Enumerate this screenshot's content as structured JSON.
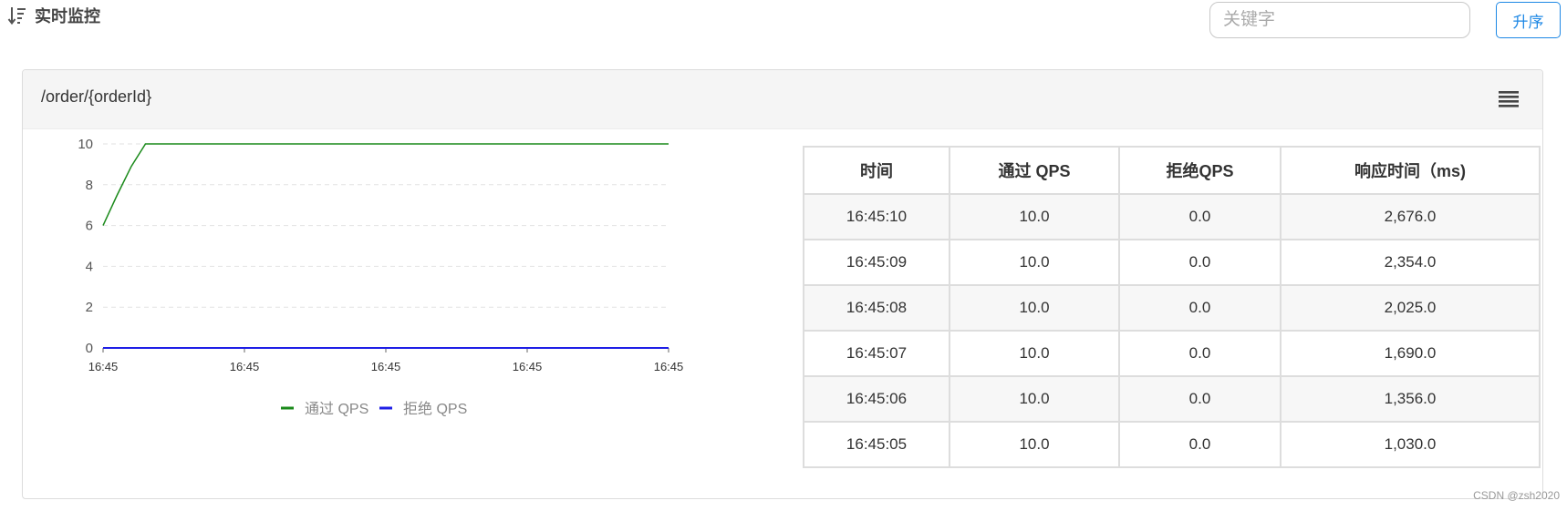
{
  "header": {
    "title": "实时监控",
    "sort_icon": "sort-descending-icon",
    "search_placeholder": "关键字",
    "search_value": "",
    "sort_button_label": "升序"
  },
  "panel": {
    "title": "/order/{orderId}",
    "menu_icon": "hamburger-menu-icon"
  },
  "chart_data": {
    "type": "line",
    "x": [
      "16:45",
      "16:45",
      "16:45",
      "16:45",
      "16:45"
    ],
    "ylim": [
      0,
      10
    ],
    "yticks": [
      0,
      2,
      4,
      6,
      8,
      10
    ],
    "grid": true,
    "legend_position": "bottom",
    "series": [
      {
        "name": "通过 QPS",
        "color": "#1a8a1a",
        "values": [
          6,
          7.5,
          8.9,
          10,
          10,
          10,
          10,
          10,
          10,
          10,
          10,
          10,
          10,
          10,
          10,
          10,
          10,
          10,
          10,
          10,
          10,
          10,
          10,
          10,
          10,
          10,
          10,
          10,
          10,
          10,
          10,
          10,
          10,
          10,
          10,
          10,
          10,
          10,
          10,
          10,
          10
        ]
      },
      {
        "name": "拒绝 QPS",
        "color": "#1f1fe6",
        "values": [
          0,
          0,
          0,
          0,
          0,
          0,
          0,
          0,
          0,
          0,
          0,
          0,
          0,
          0,
          0,
          0,
          0,
          0,
          0,
          0,
          0,
          0,
          0,
          0,
          0,
          0,
          0,
          0,
          0,
          0,
          0,
          0,
          0,
          0,
          0,
          0,
          0,
          0,
          0,
          0,
          0
        ]
      }
    ]
  },
  "table": {
    "columns": [
      "时间",
      "通过 QPS",
      "拒绝QPS",
      "响应时间（ms)"
    ],
    "rows": [
      [
        "16:45:10",
        "10.0",
        "0.0",
        "2,676.0"
      ],
      [
        "16:45:09",
        "10.0",
        "0.0",
        "2,354.0"
      ],
      [
        "16:45:08",
        "10.0",
        "0.0",
        "2,025.0"
      ],
      [
        "16:45:07",
        "10.0",
        "0.0",
        "1,690.0"
      ],
      [
        "16:45:06",
        "10.0",
        "0.0",
        "1,356.0"
      ],
      [
        "16:45:05",
        "10.0",
        "0.0",
        "1,030.0"
      ]
    ]
  },
  "watermark": "CSDN @zsh2020"
}
